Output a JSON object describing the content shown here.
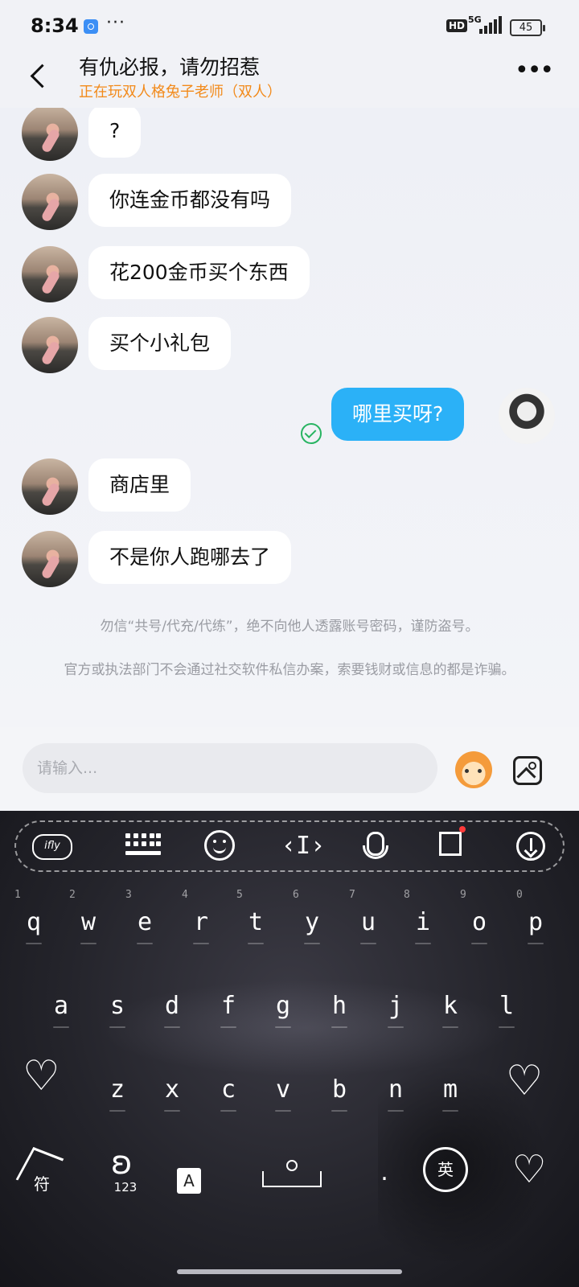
{
  "status_bar": {
    "time": "8:34",
    "dots": "···",
    "hd": "HD",
    "network": "5G",
    "battery": "45"
  },
  "header": {
    "title": "有仇必报，请勿招惹",
    "subtitle": "正在玩双人格兔子老师（双人）"
  },
  "messages": [
    {
      "from": "other",
      "text": "?"
    },
    {
      "from": "other",
      "text": "你连金币都没有吗"
    },
    {
      "from": "other",
      "text": "花200金币买个东西"
    },
    {
      "from": "other",
      "text": "买个小礼包"
    },
    {
      "from": "me",
      "text": "哪里买呀?",
      "status": "read"
    },
    {
      "from": "other",
      "text": "商店里"
    },
    {
      "from": "other",
      "text": "不是你人跑哪去了"
    }
  ],
  "notices": [
    "勿信“共号/代充/代练”，绝不向他人透露账号密码，谨防盗号。",
    "官方或执法部门不会通过社交软件私信办案，索要钱财或信息的都是诈骗。"
  ],
  "input": {
    "placeholder": "请输入..."
  },
  "keyboard": {
    "toolbar_brand": "ifly",
    "row1": [
      "q",
      "w",
      "e",
      "r",
      "t",
      "y",
      "u",
      "i",
      "o",
      "p"
    ],
    "row1_hints": [
      "1",
      "2",
      "3",
      "4",
      "5",
      "6",
      "7",
      "8",
      "9",
      "0"
    ],
    "row2": [
      "a",
      "s",
      "d",
      "f",
      "g",
      "h",
      "j",
      "k",
      "l"
    ],
    "row3": [
      "z",
      "x",
      "c",
      "v",
      "b",
      "n",
      "m"
    ],
    "symbol_label": "符",
    "num_label": "123",
    "lang_label": "A",
    "period_label": ".",
    "cn_en_label": "英"
  },
  "colors": {
    "out_bubble": "#2bb1f7",
    "subtitle": "#f28a1a",
    "read_check": "#28b462"
  }
}
